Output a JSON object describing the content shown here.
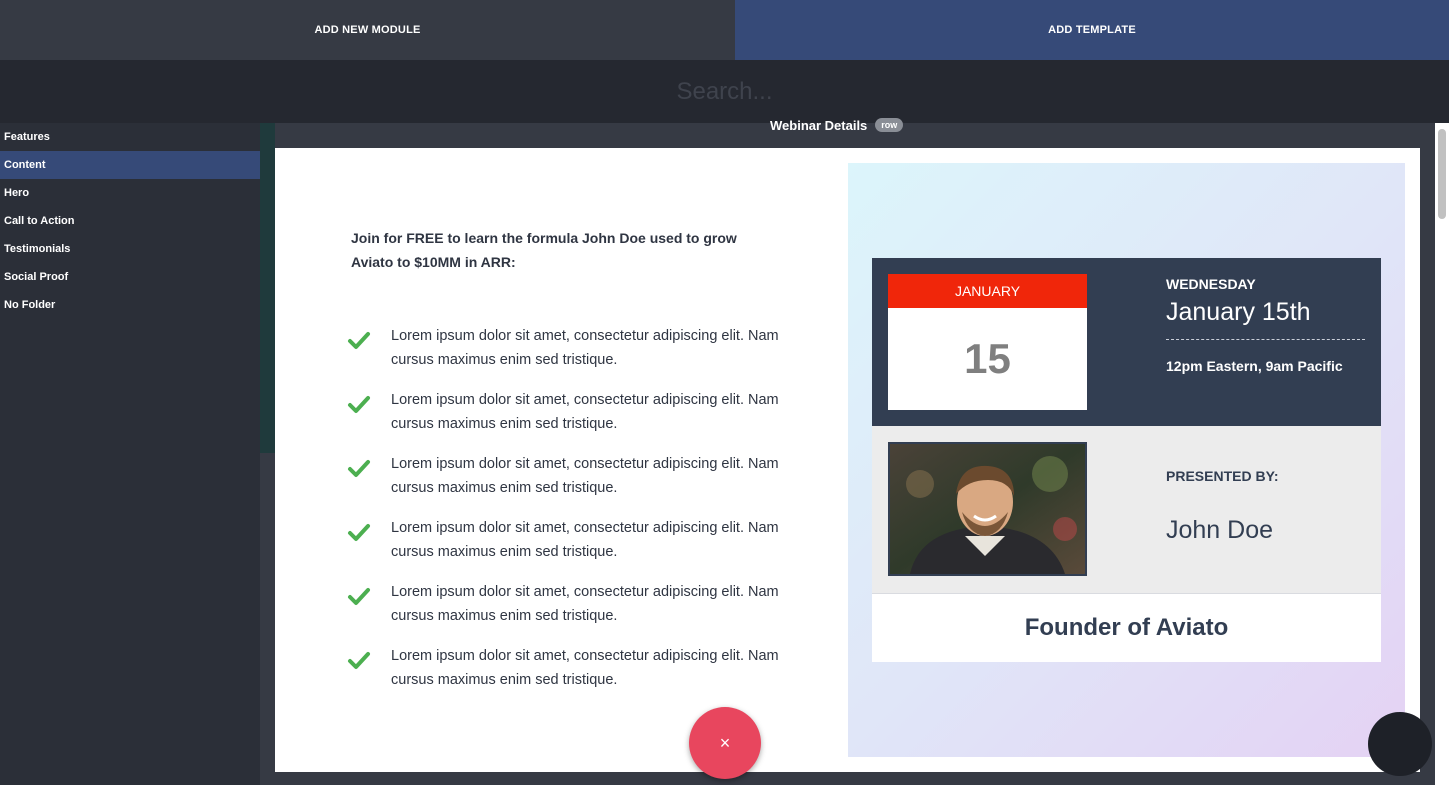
{
  "tabs": {
    "add_module": "ADD NEW MODULE",
    "add_template": "ADD TEMPLATE"
  },
  "search": {
    "placeholder": "Search..."
  },
  "sidebar": {
    "items": [
      {
        "label": "Features"
      },
      {
        "label": "Content"
      },
      {
        "label": "Hero"
      },
      {
        "label": "Call to Action"
      },
      {
        "label": "Testimonials"
      },
      {
        "label": "Social Proof"
      },
      {
        "label": "No Folder"
      }
    ],
    "active_index": 1
  },
  "template": {
    "row_title": "Webinar Details",
    "row_badge": "row",
    "intro": "Join for FREE to learn the formula John Doe used to grow Aviato to $10MM in ARR:",
    "bullets": [
      "Lorem ipsum dolor sit amet, consectetur adipiscing elit. Nam cursus maximus enim sed tristique.",
      "Lorem ipsum dolor sit amet, consectetur adipiscing elit. Nam cursus maximus enim sed tristique.",
      "Lorem ipsum dolor sit amet, consectetur adipiscing elit. Nam cursus maximus enim sed tristique.",
      "Lorem ipsum dolor sit amet, consectetur adipiscing elit. Nam cursus maximus enim sed tristique.",
      "Lorem ipsum dolor sit amet, consectetur adipiscing elit. Nam cursus maximus enim sed tristique.",
      "Lorem ipsum dolor sit amet, consectetur adipiscing elit. Nam cursus maximus enim sed tristique."
    ],
    "calendar": {
      "month": "JANUARY",
      "day": "15"
    },
    "event": {
      "weekday": "WEDNESDAY",
      "date": "January 15th",
      "time": "12pm Eastern, 9am Pacific"
    },
    "presenter": {
      "label": "PRESENTED BY:",
      "name": "John Doe",
      "title": "Founder of Aviato"
    }
  },
  "fab": {
    "close_symbol": "×"
  },
  "colors": {
    "accent": "#364a78",
    "check": "#4caf50",
    "calendar_red": "#f0260a",
    "fab": "#e8465e",
    "navy": "#323e52"
  },
  "icons": {
    "check": "check-icon",
    "close": "close-icon",
    "avatar": "presenter-photo"
  }
}
